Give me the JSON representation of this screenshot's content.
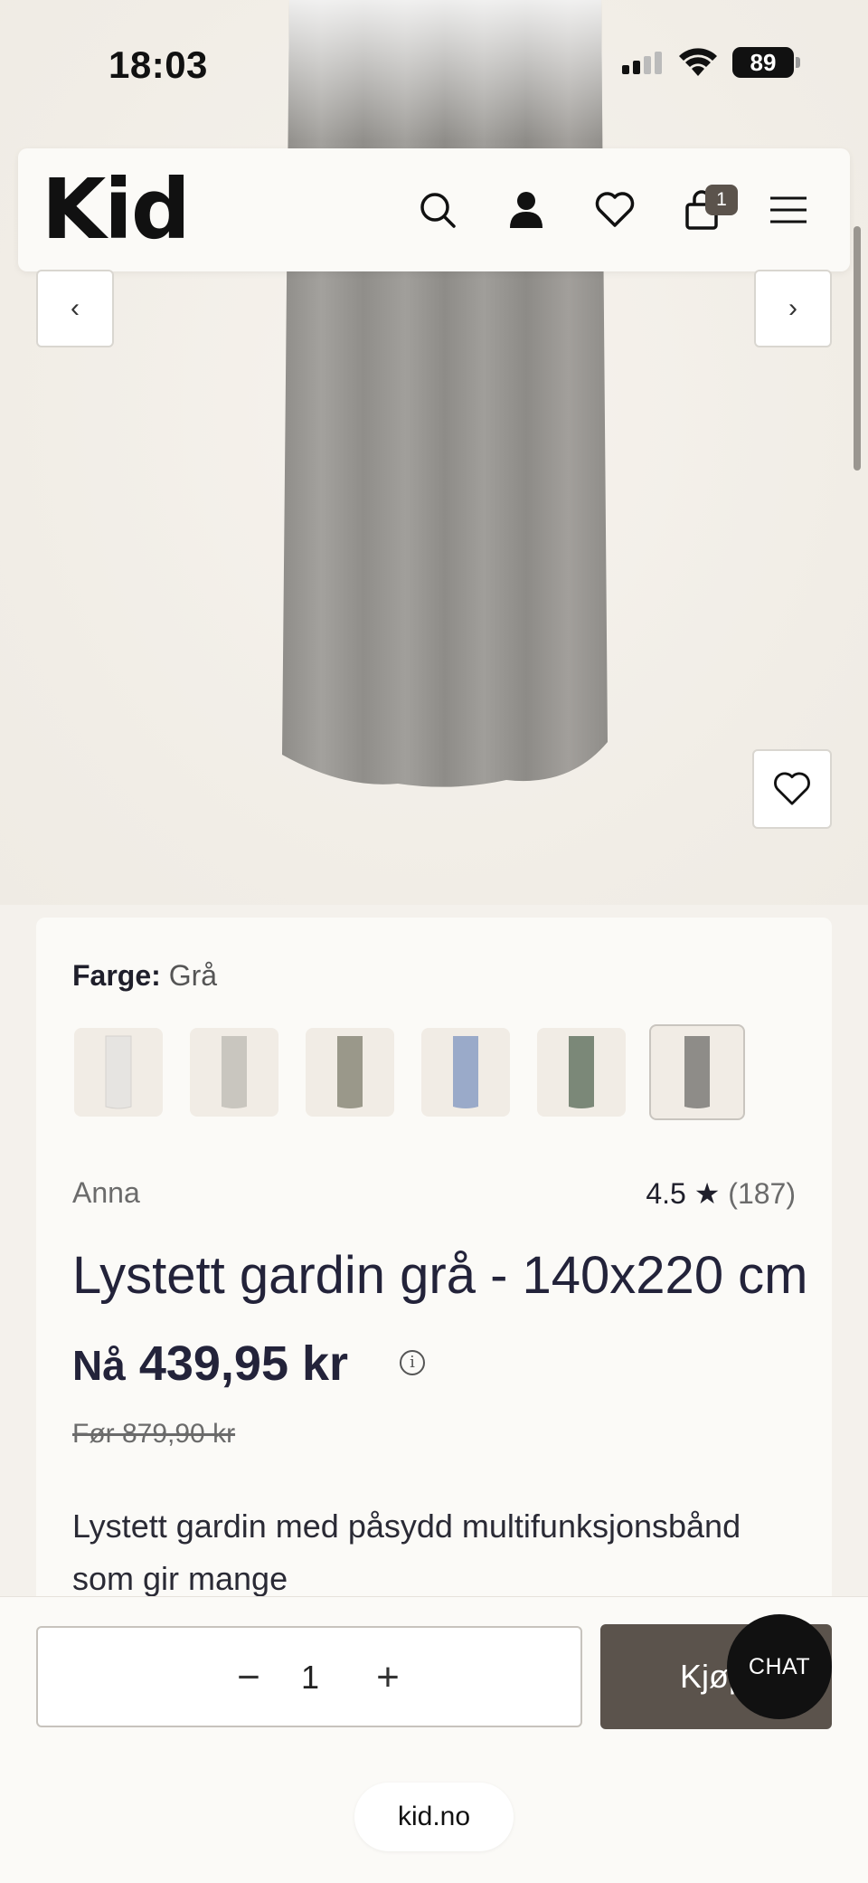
{
  "status_bar": {
    "time": "18:03",
    "battery": "89"
  },
  "header": {
    "logo": "Kid",
    "cart_count": "1",
    "icons": [
      "search-icon",
      "account-icon",
      "heart-icon",
      "cart-icon",
      "menu-icon"
    ]
  },
  "gallery": {
    "prev_label": "‹",
    "next_label": "›"
  },
  "product": {
    "color_label": "Farge:",
    "color_value": "Grå",
    "swatches": [
      "white",
      "light-grey",
      "olive",
      "blue",
      "green",
      "grey"
    ],
    "brand": "Anna",
    "rating_value": "4.5",
    "rating_star": "★",
    "rating_count": "(187)",
    "title": "Lystett gardin grå - 140x220 cm",
    "price_prefix": "Nå",
    "price": "439,95 kr",
    "old_price": "Før 879,90 kr",
    "description": "Lystett gardin med påsydd multifunksjonsbånd som gir mange"
  },
  "buy_bar": {
    "qty_minus": "−",
    "qty_value": "1",
    "qty_plus": "+",
    "buy_label": "Kjøp",
    "chat_label": "CHAT"
  },
  "browser": {
    "url": "kid.no"
  },
  "colors": {
    "accent": "#5b534c",
    "card": "#fbfaf7",
    "background": "#f4f1ec"
  }
}
